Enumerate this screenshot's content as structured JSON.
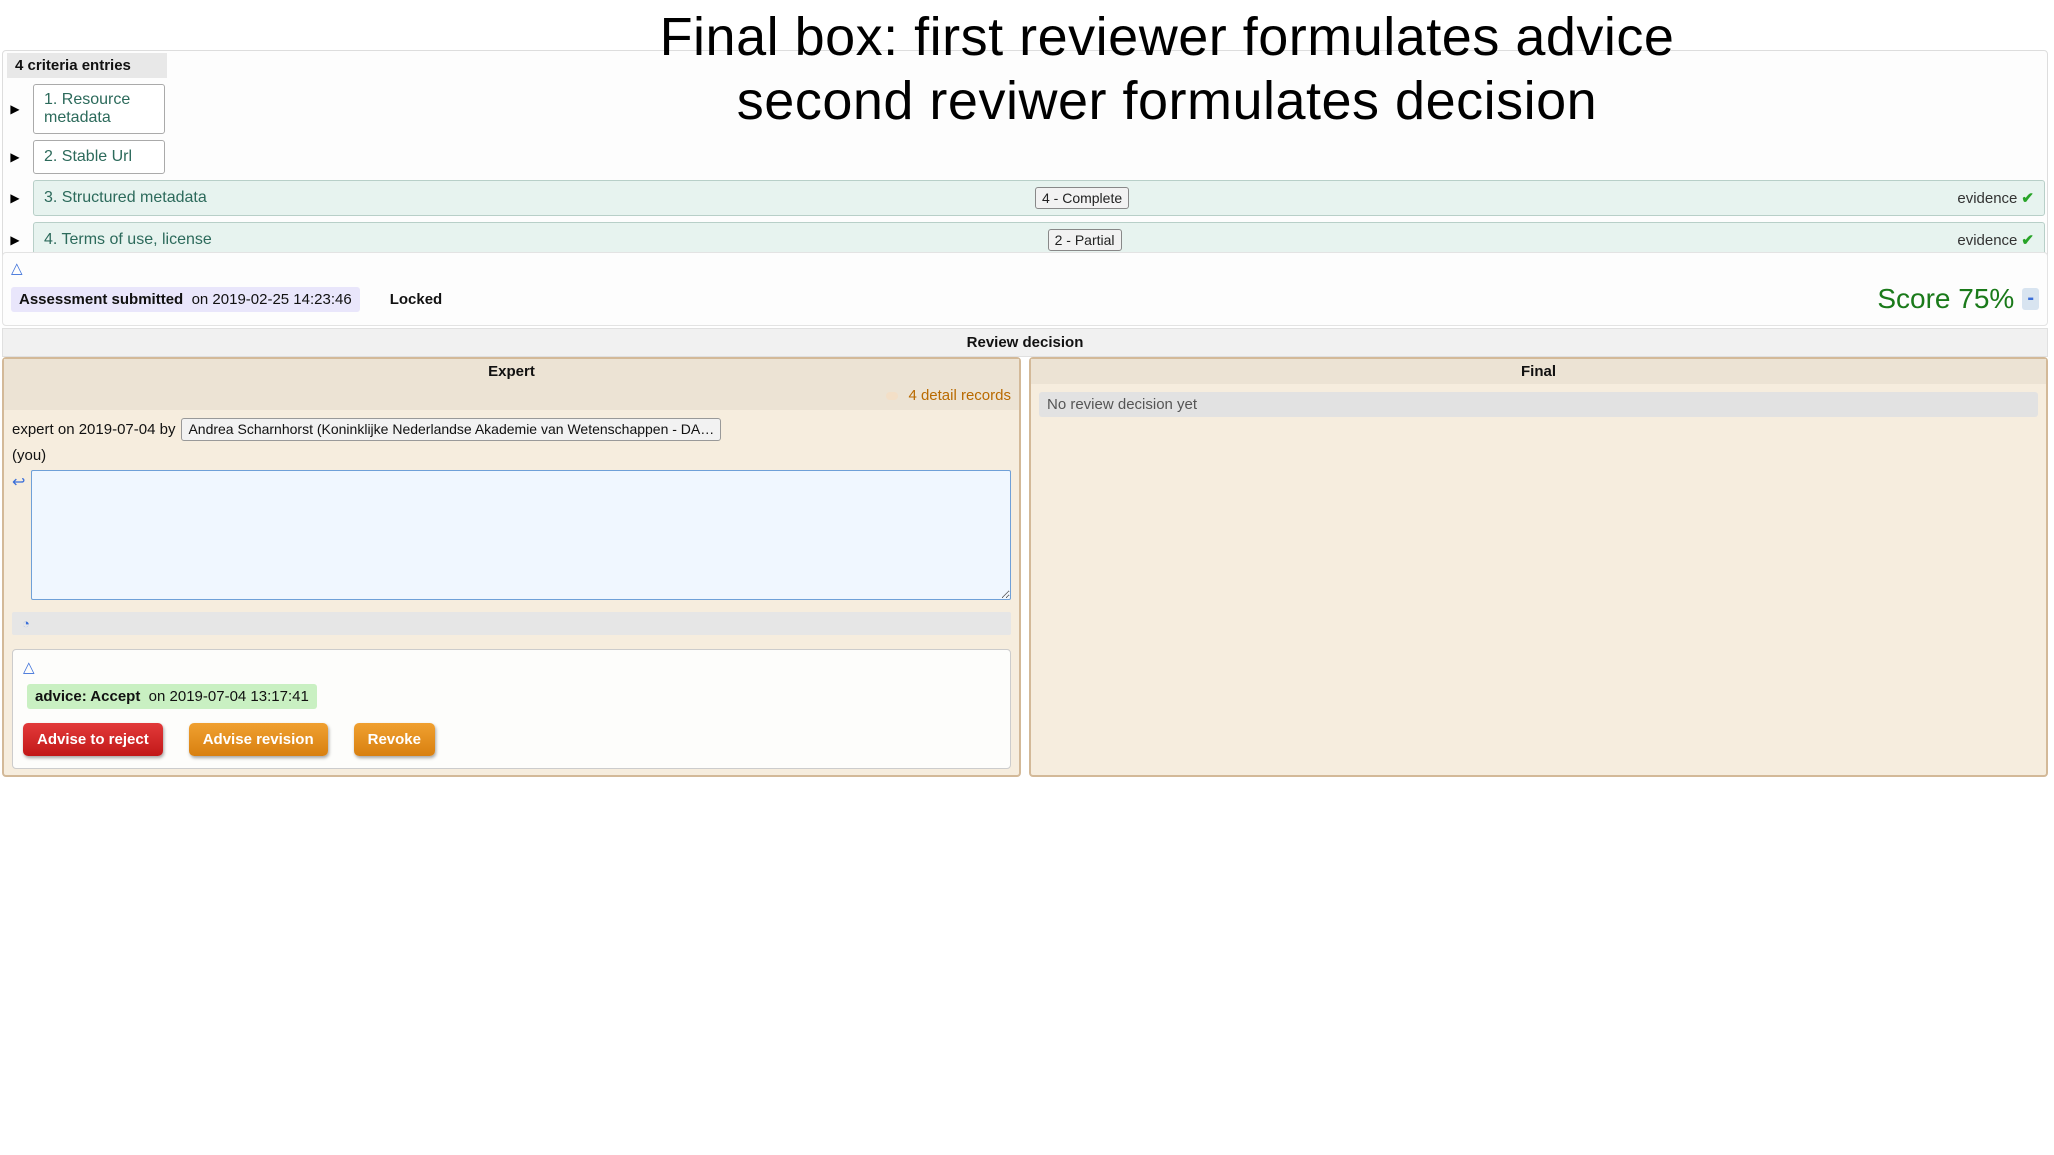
{
  "overlay": {
    "line1": "Final box: first reviewer formulates advice",
    "line2": "second reviwer formulates decision"
  },
  "criteria": {
    "header": "4 criteria entries",
    "items": [
      {
        "label": "1. Resource metadata",
        "score": "",
        "evidence": false,
        "narrow": true
      },
      {
        "label": "2. Stable Url",
        "score": "",
        "evidence": false,
        "narrow": true
      },
      {
        "label": "3. Structured metadata",
        "score": "4 - Complete",
        "evidence": true,
        "narrow": false
      },
      {
        "label": "4. Terms of use, license",
        "score": "2 - Partial",
        "evidence": true,
        "narrow": false
      }
    ],
    "evidence_label": "evidence"
  },
  "status": {
    "submitted_label": "Assessment submitted",
    "submitted_on": "on 2019-02-25 14:23:46",
    "locked": "Locked",
    "score_label": "Score 75%"
  },
  "review": {
    "header": "Review decision",
    "expert": {
      "title": "Expert",
      "detail_records": "4 detail records",
      "by_prefix": "expert on 2019-07-04 by",
      "reviewer": "Andrea Scharnhorst (Koninklijke Nederlandse Akademie van Wetenschappen - DANS) from ⚑",
      "you": "(you)",
      "textarea_value": "",
      "advice_label": "advice: Accept",
      "advice_on": "on 2019-07-04 13:17:41",
      "buttons": {
        "reject": "Advise to reject",
        "revision": "Advise revision",
        "revoke": "Revoke"
      }
    },
    "final": {
      "title": "Final",
      "no_decision": "No review decision yet"
    }
  }
}
